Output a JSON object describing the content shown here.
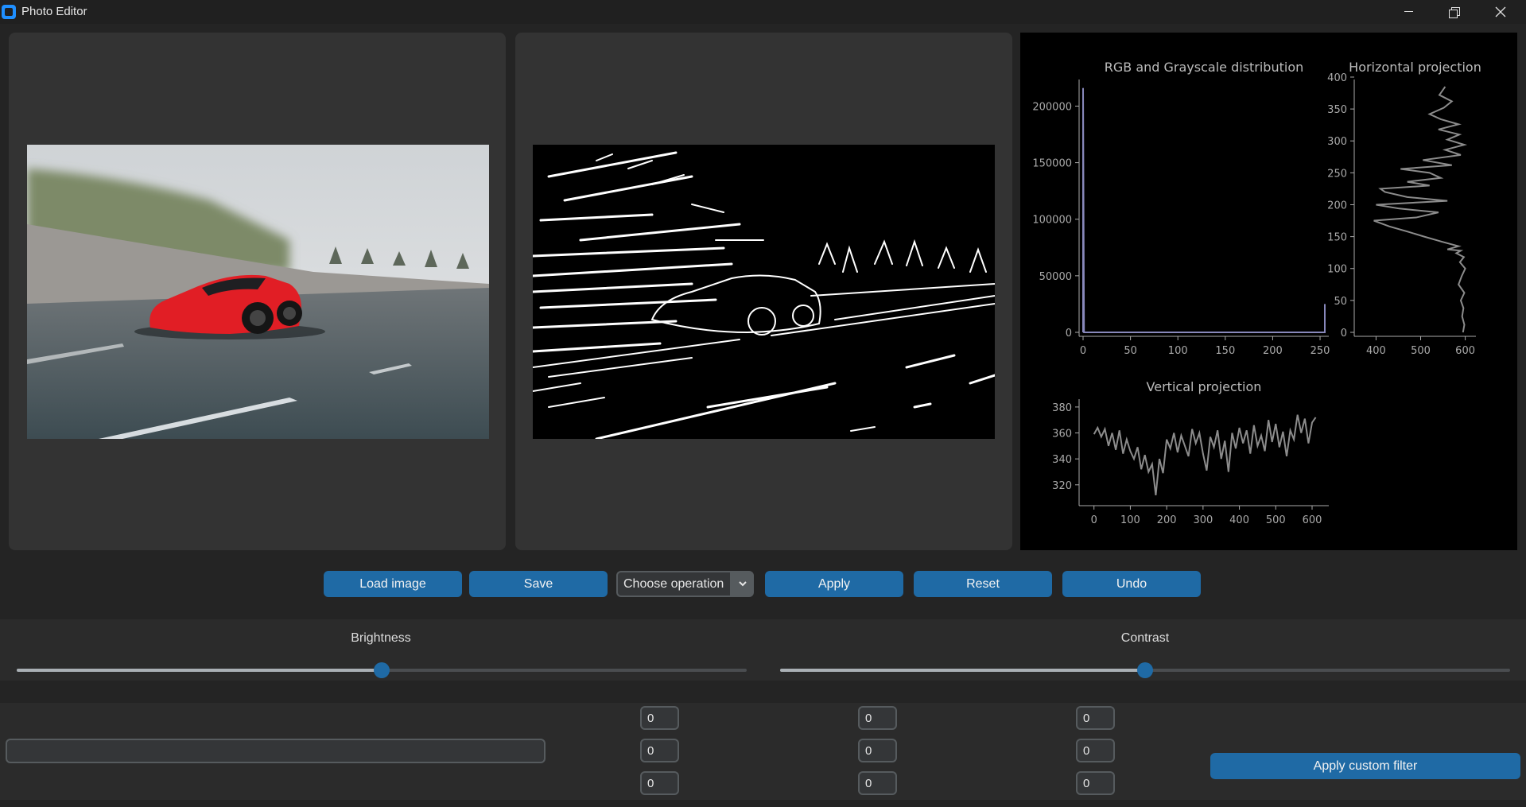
{
  "window": {
    "title": "Photo Editor",
    "app_icon": "app-icon",
    "controls": [
      "minimize-icon",
      "maximize-icon",
      "close-icon"
    ]
  },
  "colors": {
    "background": "#242424",
    "panel": "#333333",
    "accent": "#1f6aa5",
    "plot_line": "#8c8c8c",
    "hist_line": "#8888bb"
  },
  "toolbar": {
    "load_label": "Load image",
    "save_label": "Save",
    "operation_value": "Choose operation",
    "apply_label": "Apply",
    "reset_label": "Reset",
    "undo_label": "Undo"
  },
  "sliders": {
    "brightness": {
      "label": "Brightness",
      "value_fraction": 0.5
    },
    "contrast": {
      "label": "Contrast",
      "value_fraction": 0.5
    }
  },
  "custom_filter": {
    "kernel": [
      [
        "0",
        "0",
        "0"
      ],
      [
        "0",
        "0",
        "0"
      ],
      [
        "0",
        "0",
        "0"
      ]
    ],
    "text_value": "",
    "apply_label": "Apply custom filter"
  },
  "chart_data": [
    {
      "type": "line",
      "title": "RGB and Grayscale distribution",
      "xticks": [
        "0",
        "50",
        "100",
        "150",
        "200",
        "250"
      ],
      "yticks": [
        "0",
        "50000",
        "100000",
        "150000",
        "200000"
      ],
      "xlim": [
        0,
        255
      ],
      "ylim": [
        0,
        220000
      ],
      "series": [
        {
          "x": [
            0,
            0,
            1,
            2,
            253,
            254,
            255,
            255
          ],
          "y": [
            0,
            216000,
            0,
            0,
            0,
            0,
            0,
            25000
          ]
        }
      ]
    },
    {
      "type": "line",
      "title": "Horizontal projection",
      "xticks": [
        "400",
        "500",
        "600"
      ],
      "yticks": [
        "0",
        "50",
        "100",
        "150",
        "200",
        "250",
        "300",
        "350",
        "400"
      ],
      "xlim": [
        360,
        615
      ],
      "ylim": [
        0,
        390
      ],
      "series": [
        {
          "x": [
            595,
            598,
            593,
            596,
            590,
            598,
            585,
            592,
            600,
            588,
            597,
            580,
            590,
            560,
            585,
            548,
            508,
            470,
            430,
            395,
            490,
            540,
            452,
            400,
            560,
            470,
            420,
            410,
            520,
            470,
            545,
            520,
            455,
            570,
            505,
            590,
            555,
            598,
            560,
            587,
            540,
            585,
            545,
            520,
            552,
            570,
            542,
            555
          ],
          "y": [
            0,
            12,
            25,
            38,
            50,
            62,
            75,
            88,
            100,
            110,
            118,
            124,
            128,
            130,
            135,
            142,
            150,
            158,
            166,
            175,
            180,
            188,
            194,
            200,
            206,
            212,
            220,
            225,
            230,
            236,
            242,
            250,
            256,
            262,
            270,
            278,
            286,
            294,
            302,
            310,
            318,
            326,
            334,
            342,
            352,
            362,
            372,
            385
          ]
        }
      ]
    },
    {
      "type": "line",
      "title": "Vertical projection",
      "xticks": [
        "0",
        "100",
        "200",
        "300",
        "400",
        "500",
        "600"
      ],
      "yticks": [
        "320",
        "340",
        "360",
        "380"
      ],
      "xlim": [
        -30,
        635
      ],
      "ylim": [
        307,
        383
      ],
      "series": [
        {
          "x": [
            0,
            10,
            20,
            30,
            40,
            50,
            60,
            70,
            80,
            90,
            100,
            110,
            120,
            130,
            140,
            150,
            160,
            170,
            180,
            190,
            200,
            210,
            220,
            230,
            240,
            250,
            260,
            270,
            280,
            290,
            300,
            310,
            320,
            330,
            340,
            350,
            360,
            370,
            380,
            390,
            400,
            410,
            420,
            430,
            440,
            450,
            460,
            470,
            480,
            490,
            500,
            510,
            520,
            530,
            540,
            550,
            560,
            570,
            580,
            590,
            600,
            610
          ],
          "y": [
            359,
            364,
            357,
            363,
            350,
            360,
            347,
            362,
            344,
            355,
            346,
            340,
            349,
            332,
            343,
            330,
            336,
            312,
            340,
            329,
            355,
            348,
            360,
            345,
            358,
            350,
            342,
            363,
            352,
            360,
            344,
            331,
            357,
            349,
            362,
            340,
            354,
            330,
            360,
            348,
            364,
            352,
            362,
            344,
            366,
            350,
            358,
            346,
            370,
            353,
            367,
            349,
            361,
            342,
            362,
            355,
            374,
            360,
            371,
            352,
            368,
            372
          ]
        }
      ]
    }
  ]
}
